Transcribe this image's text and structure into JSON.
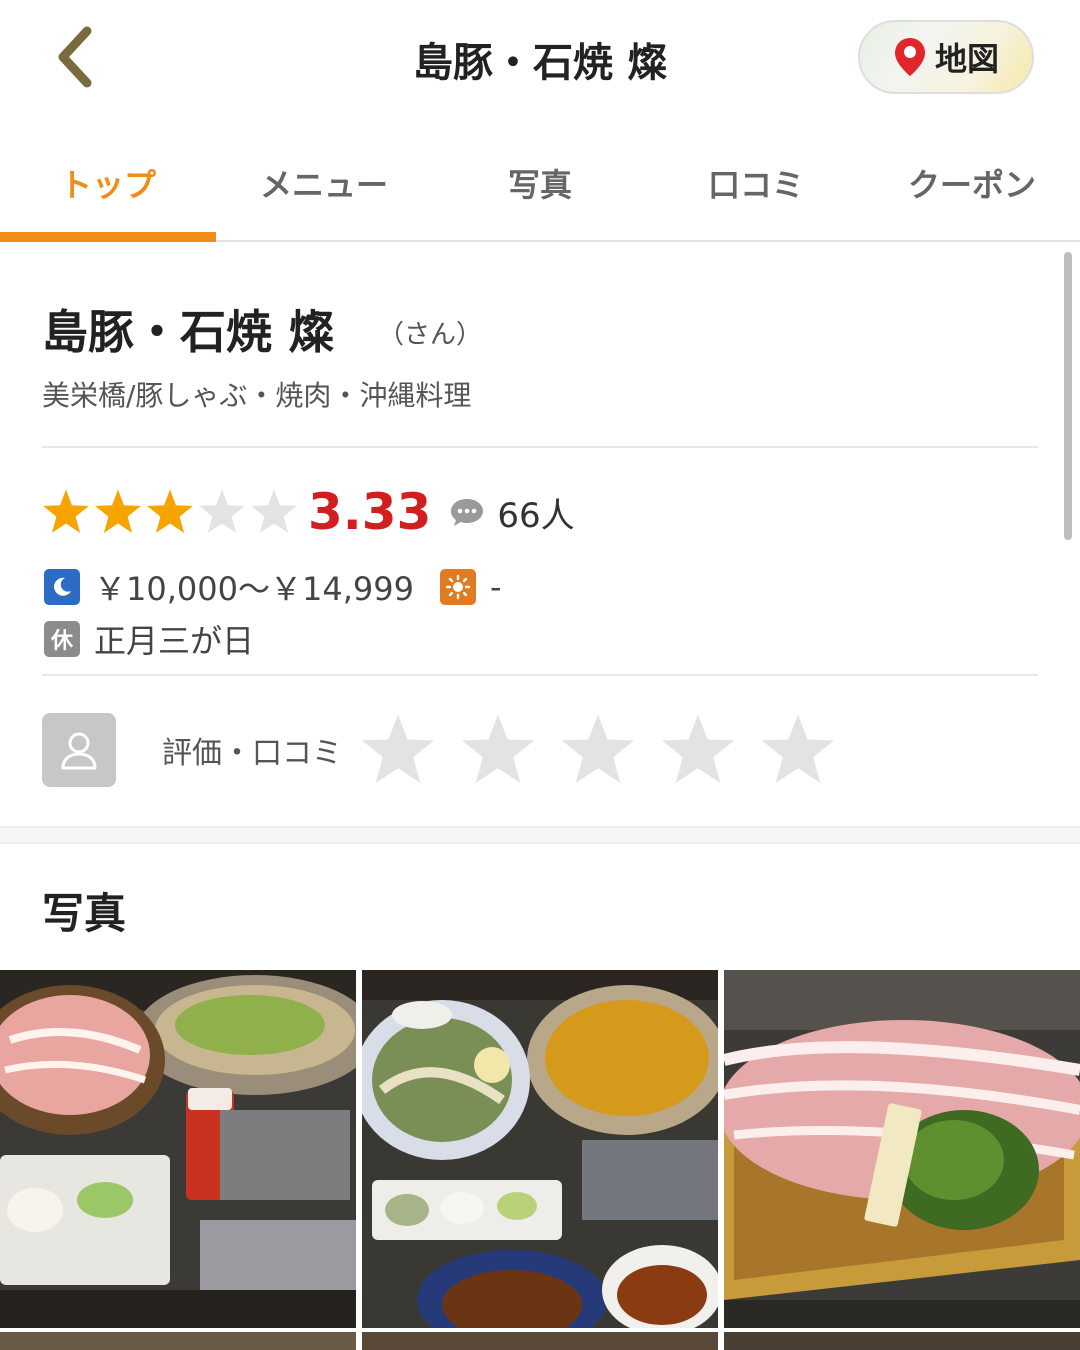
{
  "header": {
    "title": "島豚・石焼 燦",
    "map_label": "地図"
  },
  "tabs": [
    {
      "label": "トップ",
      "active": true
    },
    {
      "label": "メニュー",
      "active": false
    },
    {
      "label": "写真",
      "active": false
    },
    {
      "label": "口コミ",
      "active": false
    },
    {
      "label": "クーポン",
      "active": false
    }
  ],
  "shop": {
    "name": "島豚・石焼 燦",
    "kana": "（さん）",
    "genre": "美栄橋/豚しゃぶ・焼肉・沖縄料理",
    "rating": "3.33",
    "rating_stars": 3,
    "review_count": "66人",
    "dinner_price": "￥10,000〜￥14,999",
    "lunch_price": "-",
    "holiday_icon": "休",
    "holiday": "正月三が日"
  },
  "my_review": {
    "label": "評価・口コミ",
    "stars": 0
  },
  "photos_section": {
    "title": "写真",
    "photos": [
      {
        "icon": "pork-shabu-set-photo"
      },
      {
        "icon": "hotpot-and-dishes-photo"
      },
      {
        "icon": "premium-pork-platter-photo"
      }
    ]
  },
  "colors": {
    "accent": "#f08c17",
    "rating_red": "#d11f1f",
    "star_on": "#f6a400",
    "star_off": "#e3e3e3",
    "moon_blue": "#2c6cc4",
    "sun_orange": "#e07b22"
  }
}
